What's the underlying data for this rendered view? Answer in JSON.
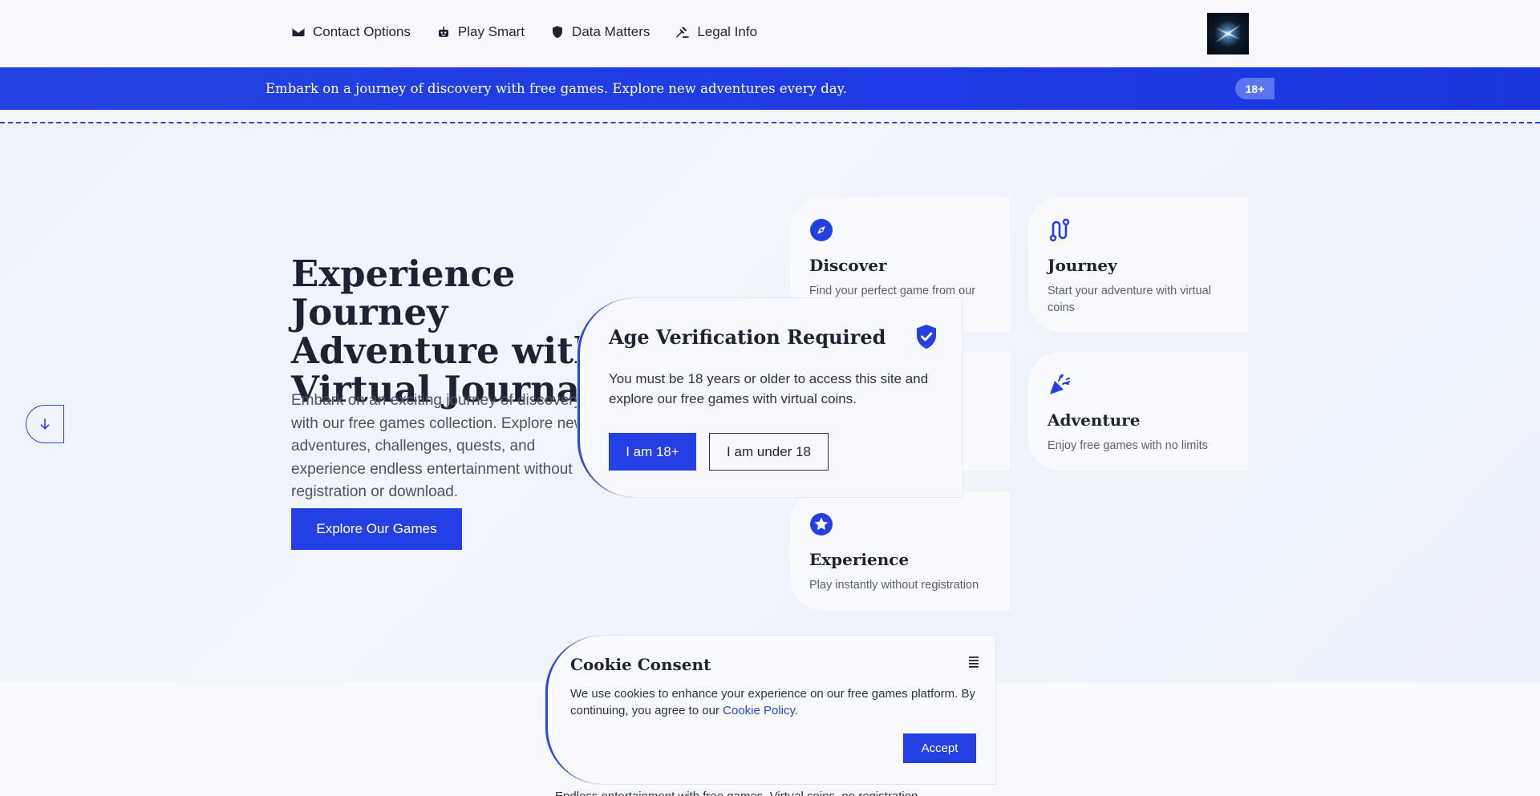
{
  "nav": {
    "links": [
      {
        "label": "Contact Options",
        "icon": "mail-icon"
      },
      {
        "label": "Play Smart",
        "icon": "robot-icon"
      },
      {
        "label": "Data Matters",
        "icon": "shield-icon"
      },
      {
        "label": "Legal Info",
        "icon": "gavel-icon"
      }
    ]
  },
  "banner": {
    "text": "Embark on a journey of discovery with free games. Explore new adventures every day.",
    "age_badge": "18+"
  },
  "hero": {
    "title": "Experience Journey Adventure with Virtual Journal",
    "description": "Embark on an exciting journey of discovery with our free games collection. Explore new adventures, challenges, quests, and experience endless entertainment without registration or download.",
    "cta": "Explore Our Games"
  },
  "cards": {
    "discover": {
      "title": "Discover",
      "desc": "Find your perfect game from our"
    },
    "journey": {
      "title": "Journey",
      "desc": "Start your adventure with virtual coins"
    },
    "adventure": {
      "title": "Adventure",
      "desc": "Enjoy free games with no limits"
    },
    "experience": {
      "title": "Experience",
      "desc": "Play instantly without registration"
    }
  },
  "age_modal": {
    "title": "Age Verification Required",
    "text": "You must be 18 years or older to access this site and explore our free games with virtual coins.",
    "confirm": "I am 18+",
    "deny": "I am under 18"
  },
  "cookie": {
    "title": "Cookie Consent",
    "text_before": "We use cookies to enhance your experience on our free games platform. By continuing, you agree to our",
    "link": "Cookie Policy",
    "text_after": ".",
    "accept": "Accept"
  },
  "bottom_peek": "Endless entertainment with free games. Virtual coins, no registration.",
  "colors": {
    "accent": "#2440e5",
    "text": "#1d2333"
  }
}
